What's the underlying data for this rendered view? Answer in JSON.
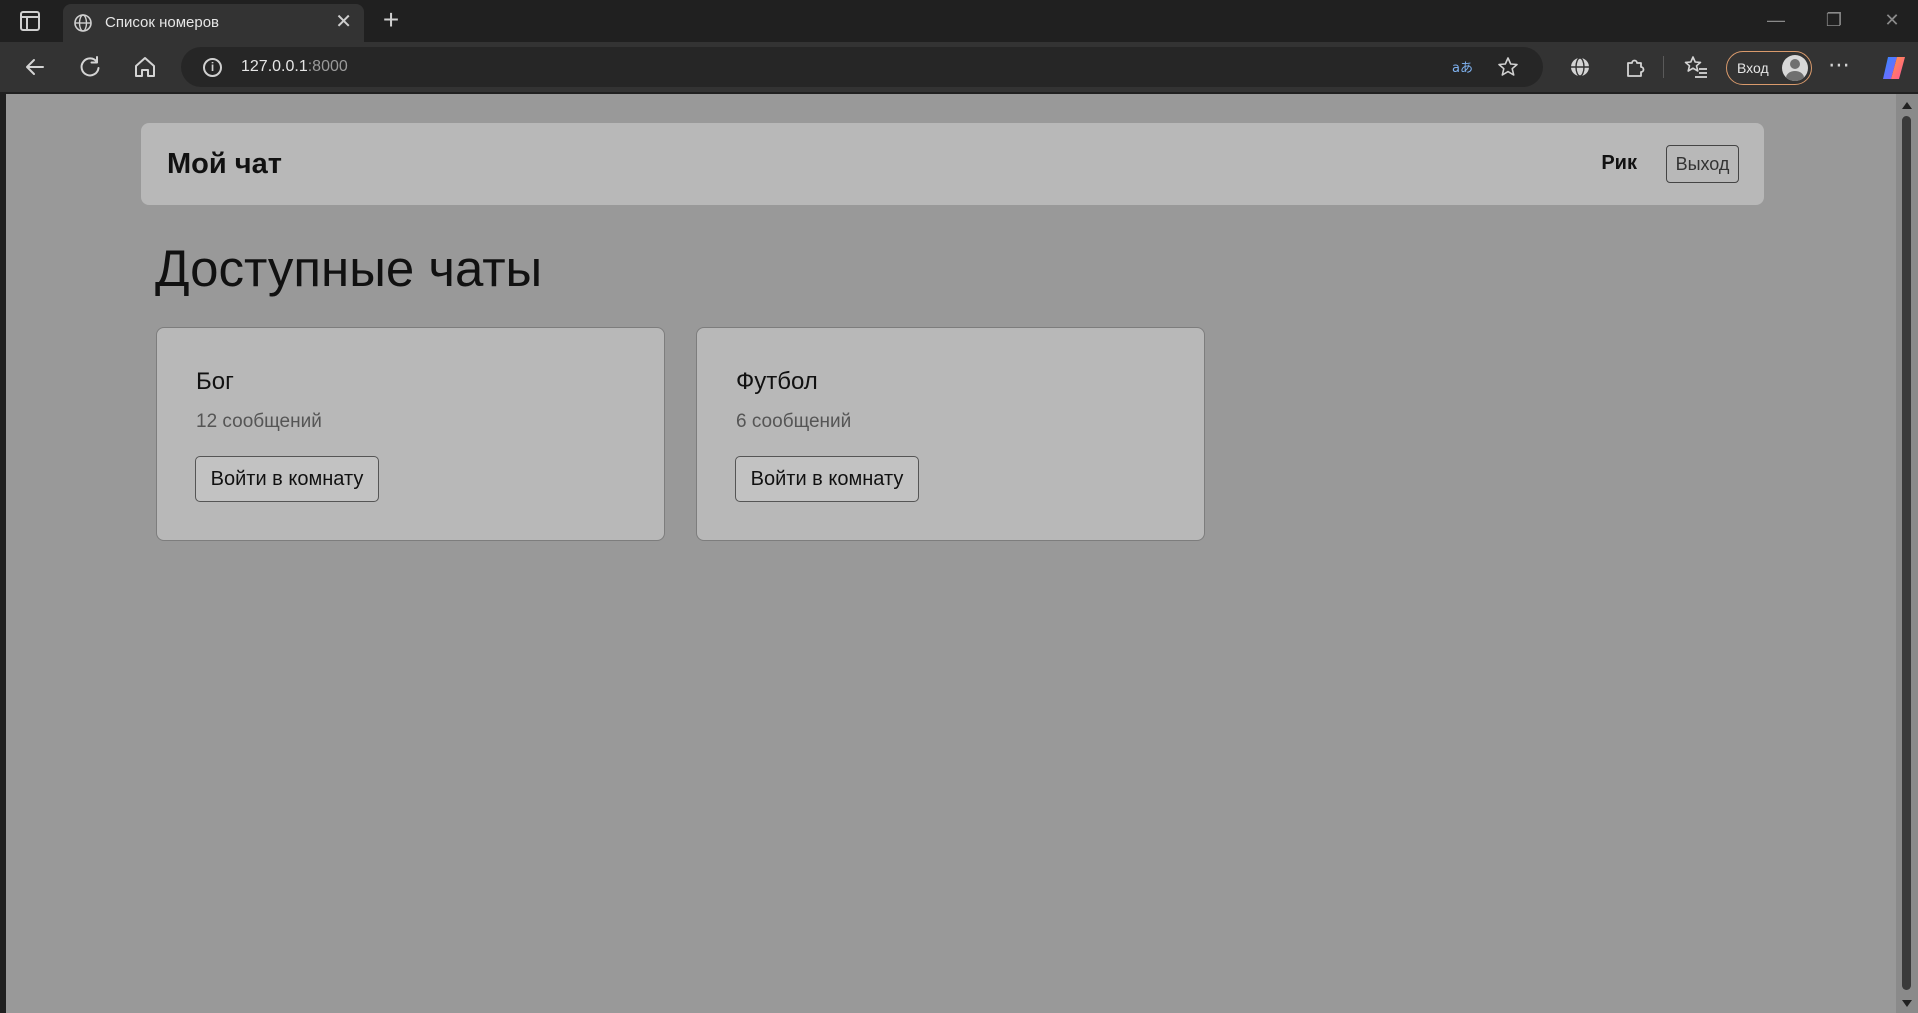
{
  "browser": {
    "tab_title": "Список номеров",
    "tab_close": "✕",
    "new_tab": "+",
    "window_controls": {
      "minimize": "—",
      "restore": "❐",
      "close": "✕"
    },
    "url_host": "127.0.0.1",
    "url_port": ":8000",
    "signin_label": "Вход",
    "more": "⋯",
    "icons": [
      "sidebar-toggle-icon",
      "globe-icon",
      "back-icon",
      "refresh-icon",
      "home-icon",
      "info-icon",
      "translate-icon",
      "star-icon",
      "vpn-globe-icon",
      "extensions-icon",
      "favorites-icon",
      "profile-avatar-icon",
      "more-icon",
      "copilot-icon"
    ]
  },
  "navbar": {
    "brand": "Мой чат",
    "username": "Рик",
    "logout_label": "Выход"
  },
  "main": {
    "heading": "Доступные чаты",
    "rooms": [
      {
        "name": "Бог",
        "count": "12 сообщений",
        "button": "Войти в комнату"
      },
      {
        "name": "Футбол",
        "count": "6 сообщений",
        "button": "Войти в комнату"
      }
    ]
  },
  "colors": {
    "overlay_background": "#999999",
    "card_background": "#b8b8b8",
    "browser_chrome": "#202020",
    "signin_border": "#d99a6c"
  }
}
